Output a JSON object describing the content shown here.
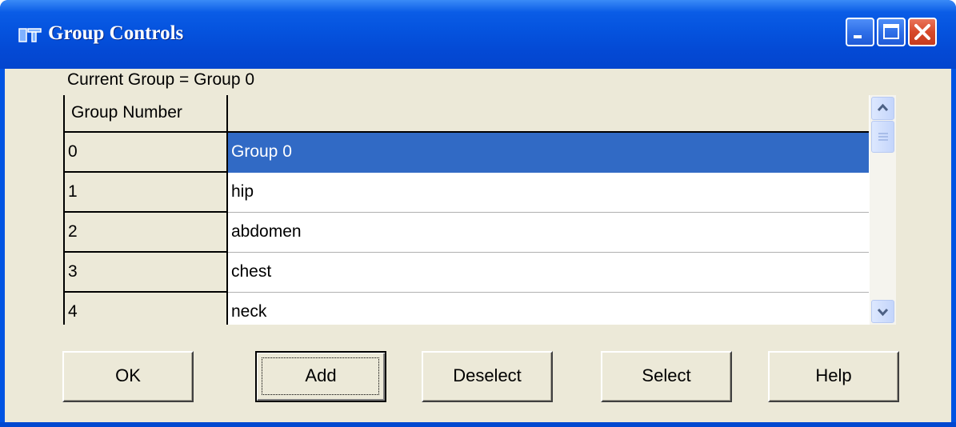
{
  "window": {
    "title": "Group Controls",
    "icon": "app-logo-icon",
    "buttons": [
      "minimize-icon",
      "maximize-icon",
      "close-icon"
    ]
  },
  "current_group_label": "Current Group = Group 0",
  "grid": {
    "columns": [
      "Group Number",
      ""
    ],
    "rows": [
      {
        "number": "0",
        "name": "Group 0",
        "selected": true
      },
      {
        "number": "1",
        "name": "hip"
      },
      {
        "number": "2",
        "name": "abdomen"
      },
      {
        "number": "3",
        "name": "chest"
      },
      {
        "number": "4",
        "name": "neck"
      }
    ]
  },
  "buttons": {
    "ok": "OK",
    "add": "Add",
    "deselect": "Deselect",
    "select": "Select",
    "help": "Help"
  },
  "colors": {
    "titlebar": "#0553de",
    "selection": "#316ac5",
    "dialog_face": "#ece9d8"
  }
}
